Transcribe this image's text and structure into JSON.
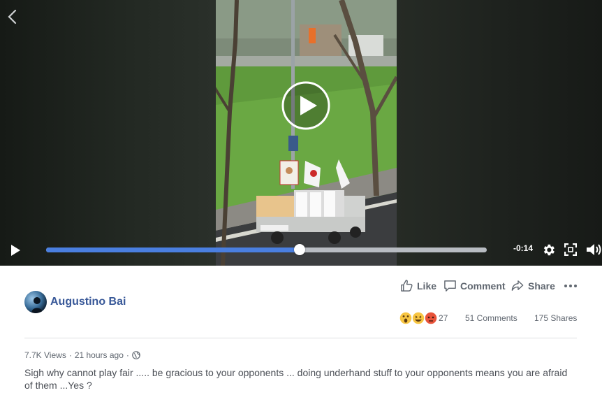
{
  "player": {
    "time_remaining": "-0:14",
    "progress_fraction": 0.575
  },
  "actions": {
    "like_label": "Like",
    "comment_label": "Comment",
    "share_label": "Share"
  },
  "post": {
    "author": "Augustino Bai",
    "views": "7.7K Views",
    "separator": "·",
    "time_ago": "21 hours ago",
    "caption": "Sigh why cannot play fair ..... be gracious to your opponents ... doing underhand stuff to your opponents means you are afraid of them ...Yes ?"
  },
  "stats": {
    "reactions_count": "27",
    "comments": "51 Comments",
    "shares": "175 Shares"
  },
  "icons": {
    "back": "chevron-left-icon",
    "play": "play-icon",
    "settings": "gear-icon",
    "fullscreen": "fullscreen-icon",
    "volume": "volume-icon",
    "like": "thumbs-up-icon",
    "comment": "speech-bubble-icon",
    "share": "share-arrow-icon",
    "more": "ellipsis-icon",
    "privacy": "globe-icon",
    "reactions": [
      "wow-icon",
      "haha-icon",
      "angry-icon"
    ]
  },
  "colors": {
    "progress": "#4a7fe0",
    "author_link": "#385898",
    "muted_text": "#606770"
  }
}
